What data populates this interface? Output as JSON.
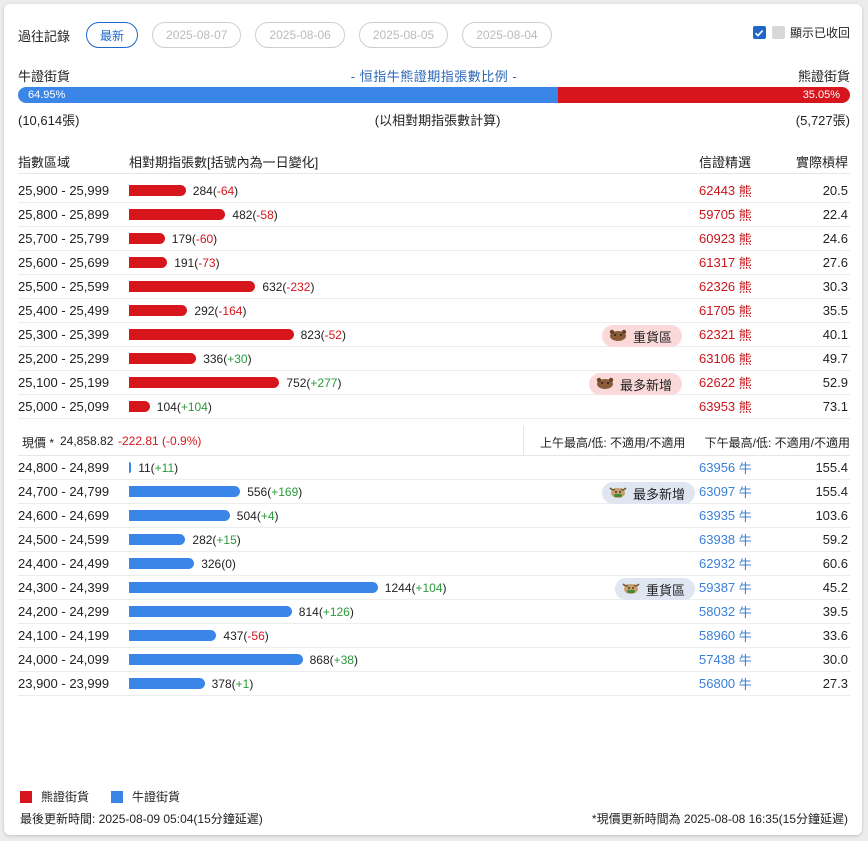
{
  "history": {
    "label": "過往記錄",
    "tabs": [
      {
        "label": "最新",
        "active": true
      },
      {
        "label": "2025-08-07",
        "active": false
      },
      {
        "label": "2025-08-06",
        "active": false
      },
      {
        "label": "2025-08-05",
        "active": false
      },
      {
        "label": "2025-08-04",
        "active": false
      }
    ]
  },
  "show_recalled": {
    "label": "顯示已收回"
  },
  "ratio": {
    "bull_label": "牛證街貨",
    "bear_label": "熊證街貨",
    "title": "- 恒指牛熊證期指張數比例 -",
    "bull_pct": "64.95%",
    "bear_pct": "35.05%",
    "bull_fraction": 0.6495,
    "bull_count": "(10,614張)",
    "bear_count": "(5,727張)",
    "note": "(以相對期指張數計算)"
  },
  "table_headers": {
    "range": "指數區域",
    "contracts": "相對期指張數[括號內為一日變化]",
    "code": "信證精選",
    "leverage": "實際槓桿"
  },
  "bear_rows": [
    {
      "range": "25,900 - 25,999",
      "value": 284,
      "change": "-64",
      "code": "62443",
      "side": "熊",
      "leverage": "20.5",
      "tag": ""
    },
    {
      "range": "25,800 - 25,899",
      "value": 482,
      "change": "-58",
      "code": "59705",
      "side": "熊",
      "leverage": "22.4",
      "tag": ""
    },
    {
      "range": "25,700 - 25,799",
      "value": 179,
      "change": "-60",
      "code": "60923",
      "side": "熊",
      "leverage": "24.6",
      "tag": ""
    },
    {
      "range": "25,600 - 25,699",
      "value": 191,
      "change": "-73",
      "code": "61317",
      "side": "熊",
      "leverage": "27.6",
      "tag": ""
    },
    {
      "range": "25,500 - 25,599",
      "value": 632,
      "change": "-232",
      "code": "62326",
      "side": "熊",
      "leverage": "30.3",
      "tag": ""
    },
    {
      "range": "25,400 - 25,499",
      "value": 292,
      "change": "-164",
      "code": "61705",
      "side": "熊",
      "leverage": "35.5",
      "tag": ""
    },
    {
      "range": "25,300 - 25,399",
      "value": 823,
      "change": "-52",
      "code": "62321",
      "side": "熊",
      "leverage": "40.1",
      "tag": "重貨區"
    },
    {
      "range": "25,200 - 25,299",
      "value": 336,
      "change": "+30",
      "code": "63106",
      "side": "熊",
      "leverage": "49.7",
      "tag": ""
    },
    {
      "range": "25,100 - 25,199",
      "value": 752,
      "change": "+277",
      "code": "62622",
      "side": "熊",
      "leverage": "52.9",
      "tag": "最多新增"
    },
    {
      "range": "25,000 - 25,099",
      "value": 104,
      "change": "+104",
      "code": "63953",
      "side": "熊",
      "leverage": "73.1",
      "tag": ""
    }
  ],
  "spot": {
    "label": "現價 *",
    "price": "24,858.82",
    "change": "-222.81 (-0.9%)",
    "am": "上午最高/低: 不適用/不適用",
    "pm": "下午最高/低: 不適用/不適用"
  },
  "bull_rows": [
    {
      "range": "24,800 - 24,899",
      "value": 11,
      "change": "+11",
      "code": "63956",
      "side": "牛",
      "leverage": "155.4",
      "tag": ""
    },
    {
      "range": "24,700 - 24,799",
      "value": 556,
      "change": "+169",
      "code": "63097",
      "side": "牛",
      "leverage": "155.4",
      "tag": "最多新增"
    },
    {
      "range": "24,600 - 24,699",
      "value": 504,
      "change": "+4",
      "code": "63935",
      "side": "牛",
      "leverage": "103.6",
      "tag": ""
    },
    {
      "range": "24,500 - 24,599",
      "value": 282,
      "change": "+15",
      "code": "63938",
      "side": "牛",
      "leverage": "59.2",
      "tag": ""
    },
    {
      "range": "24,400 - 24,499",
      "value": 326,
      "change": "0",
      "code": "62932",
      "side": "牛",
      "leverage": "60.6",
      "tag": ""
    },
    {
      "range": "24,300 - 24,399",
      "value": 1244,
      "change": "+104",
      "code": "59387",
      "side": "牛",
      "leverage": "45.2",
      "tag": "重貨區"
    },
    {
      "range": "24,200 - 24,299",
      "value": 814,
      "change": "+126",
      "code": "58032",
      "side": "牛",
      "leverage": "39.5",
      "tag": ""
    },
    {
      "range": "24,100 - 24,199",
      "value": 437,
      "change": "-56",
      "code": "58960",
      "side": "牛",
      "leverage": "33.6",
      "tag": ""
    },
    {
      "range": "24,000 - 24,099",
      "value": 868,
      "change": "+38",
      "code": "57438",
      "side": "牛",
      "leverage": "30.0",
      "tag": ""
    },
    {
      "range": "23,900 - 23,999",
      "value": 378,
      "change": "+1",
      "code": "56800",
      "side": "牛",
      "leverage": "27.3",
      "tag": ""
    }
  ],
  "legend": {
    "bear": "熊證街貨",
    "bull": "牛證街貨"
  },
  "footer": {
    "updated": "最後更新時間: 2025-08-09 05:04(15分鐘延遲)",
    "spot_updated": "*現價更新時間為 2025-08-08 16:35(15分鐘延遲)"
  },
  "colors": {
    "bear": "#d7151c",
    "bull": "#3a86e8",
    "accent": "#1e66c9"
  }
}
